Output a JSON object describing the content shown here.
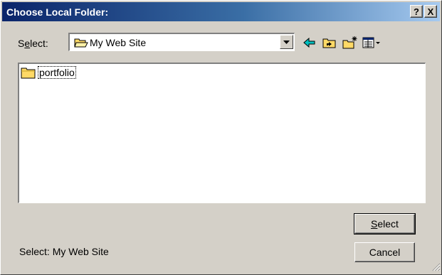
{
  "dialog": {
    "title": "Choose Local Folder:",
    "help_label": "?",
    "close_label": "X"
  },
  "select_row": {
    "label_accel": "e",
    "label_before": "S",
    "label_after": "lect:",
    "current_folder": "My Web Site"
  },
  "file_list": {
    "items": [
      {
        "name": "portfolio",
        "icon": "folder-icon"
      }
    ]
  },
  "buttons": {
    "select_label_accel": "S",
    "select_label_rest": "elect",
    "cancel_label": "Cancel"
  },
  "status": {
    "text": "Select: My Web Site"
  },
  "colors": {
    "title_start": "#0a246a",
    "title_end": "#a6caf0",
    "dialog_bg": "#d4d0c8",
    "folder": "#ffd966"
  }
}
